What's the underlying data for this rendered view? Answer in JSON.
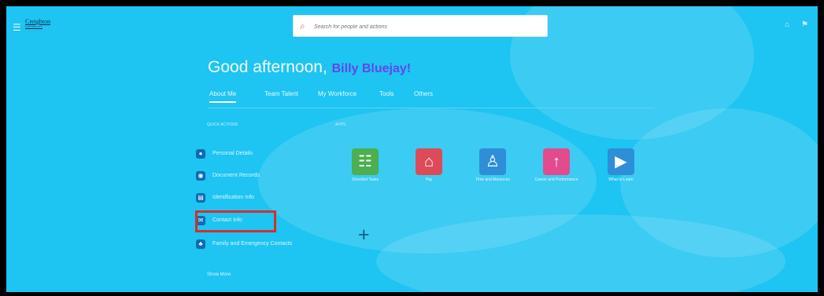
{
  "header": {
    "menu_icon": "hamburger-icon",
    "logo_text": "Creighton",
    "logo_subtext": "UNIVERSITY",
    "search_placeholder": "Search for people and actions",
    "icons": [
      "home-icon",
      "notification-icon"
    ]
  },
  "greeting": {
    "prefix": "Good afternoon, ",
    "name": "Billy Bluejay!"
  },
  "tabs": [
    {
      "label": "About Me",
      "active": true
    },
    {
      "label": "Team Talent",
      "active": false
    },
    {
      "label": "My Workforce",
      "active": false
    },
    {
      "label": "Tools",
      "active": false
    },
    {
      "label": "Others",
      "active": false
    }
  ],
  "sections": {
    "quick_actions": "QUICK ACTIONS",
    "apps": "APPS"
  },
  "quick_actions": [
    {
      "label": "Personal Details",
      "icon": "user-icon"
    },
    {
      "label": "Document Records",
      "icon": "document-icon"
    },
    {
      "label": "Identification Info",
      "icon": "id-card-icon"
    },
    {
      "label": "Contact Info",
      "icon": "mail-icon"
    },
    {
      "label": "Family and Emergency Contacts",
      "icon": "family-icon"
    }
  ],
  "apps": [
    {
      "label": "Checklist Tasks",
      "icon": "checklist-icon",
      "color": "#4caf50"
    },
    {
      "label": "Pay",
      "icon": "bank-icon",
      "color": "#de4b58"
    },
    {
      "label": "Time and Absences",
      "icon": "time-icon",
      "color": "#2f8ed8"
    },
    {
      "label": "Career and Performance",
      "icon": "career-icon",
      "color": "#e44a8e"
    },
    {
      "label": "What to Learn",
      "icon": "play-icon",
      "color": "#2f8ed8"
    }
  ],
  "show_more": "Show More",
  "colors": {
    "background": "#1ec4f2",
    "highlight": "#d32f2f",
    "name": "#6247e8"
  }
}
